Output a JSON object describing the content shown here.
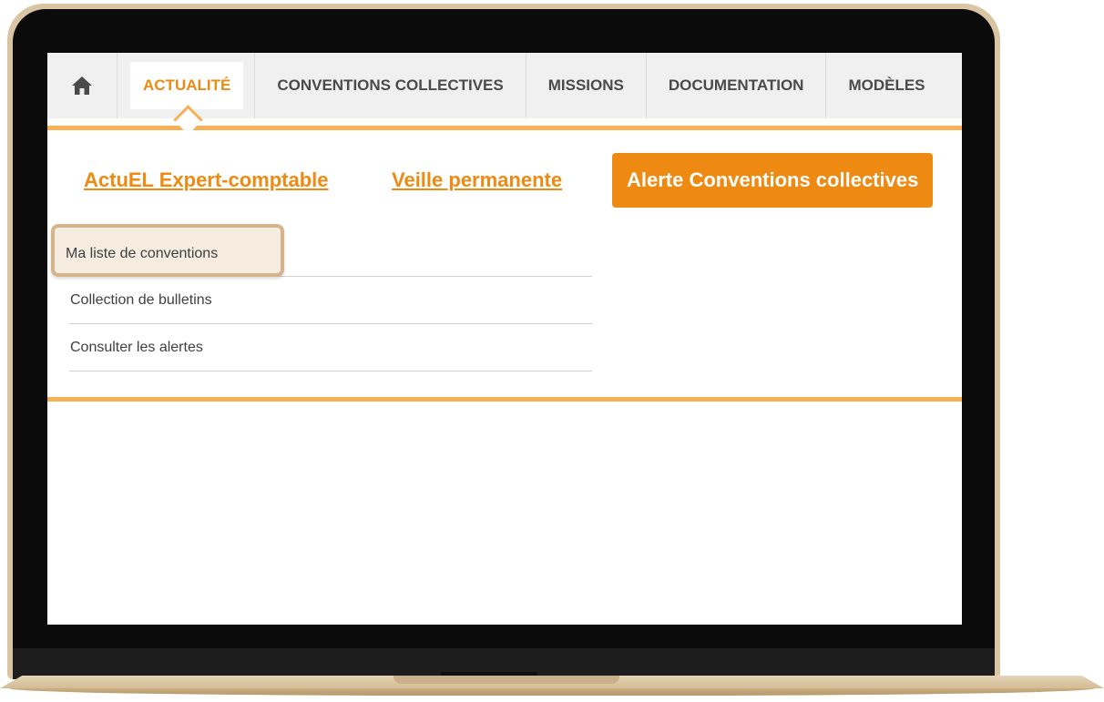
{
  "colors": {
    "accent": "#ee8a12",
    "accent_light": "#f6b156",
    "bezel_gold": "#d9c4a3",
    "nav_bg": "#f0f0f0",
    "highlight_bg": "#f6ece0",
    "highlight_border": "#d4b48a"
  },
  "nav": {
    "home_icon": "home-icon",
    "items": [
      {
        "label": "ACTUALITÉ",
        "active": true
      },
      {
        "label": "CONVENTIONS COLLECTIVES"
      },
      {
        "label": "MISSIONS"
      },
      {
        "label": "DOCUMENTATION"
      },
      {
        "label": "MODÈLES"
      }
    ]
  },
  "subnav": {
    "link1": "ActuEL Expert-comptable",
    "link2": "Veille permanente",
    "active_button": "Alerte Conventions collectives"
  },
  "menu": {
    "items": [
      {
        "label": "Ma liste de conventions",
        "highlighted": true
      },
      {
        "label": "Collection de bulletins"
      },
      {
        "label": "Consulter les alertes"
      }
    ]
  }
}
